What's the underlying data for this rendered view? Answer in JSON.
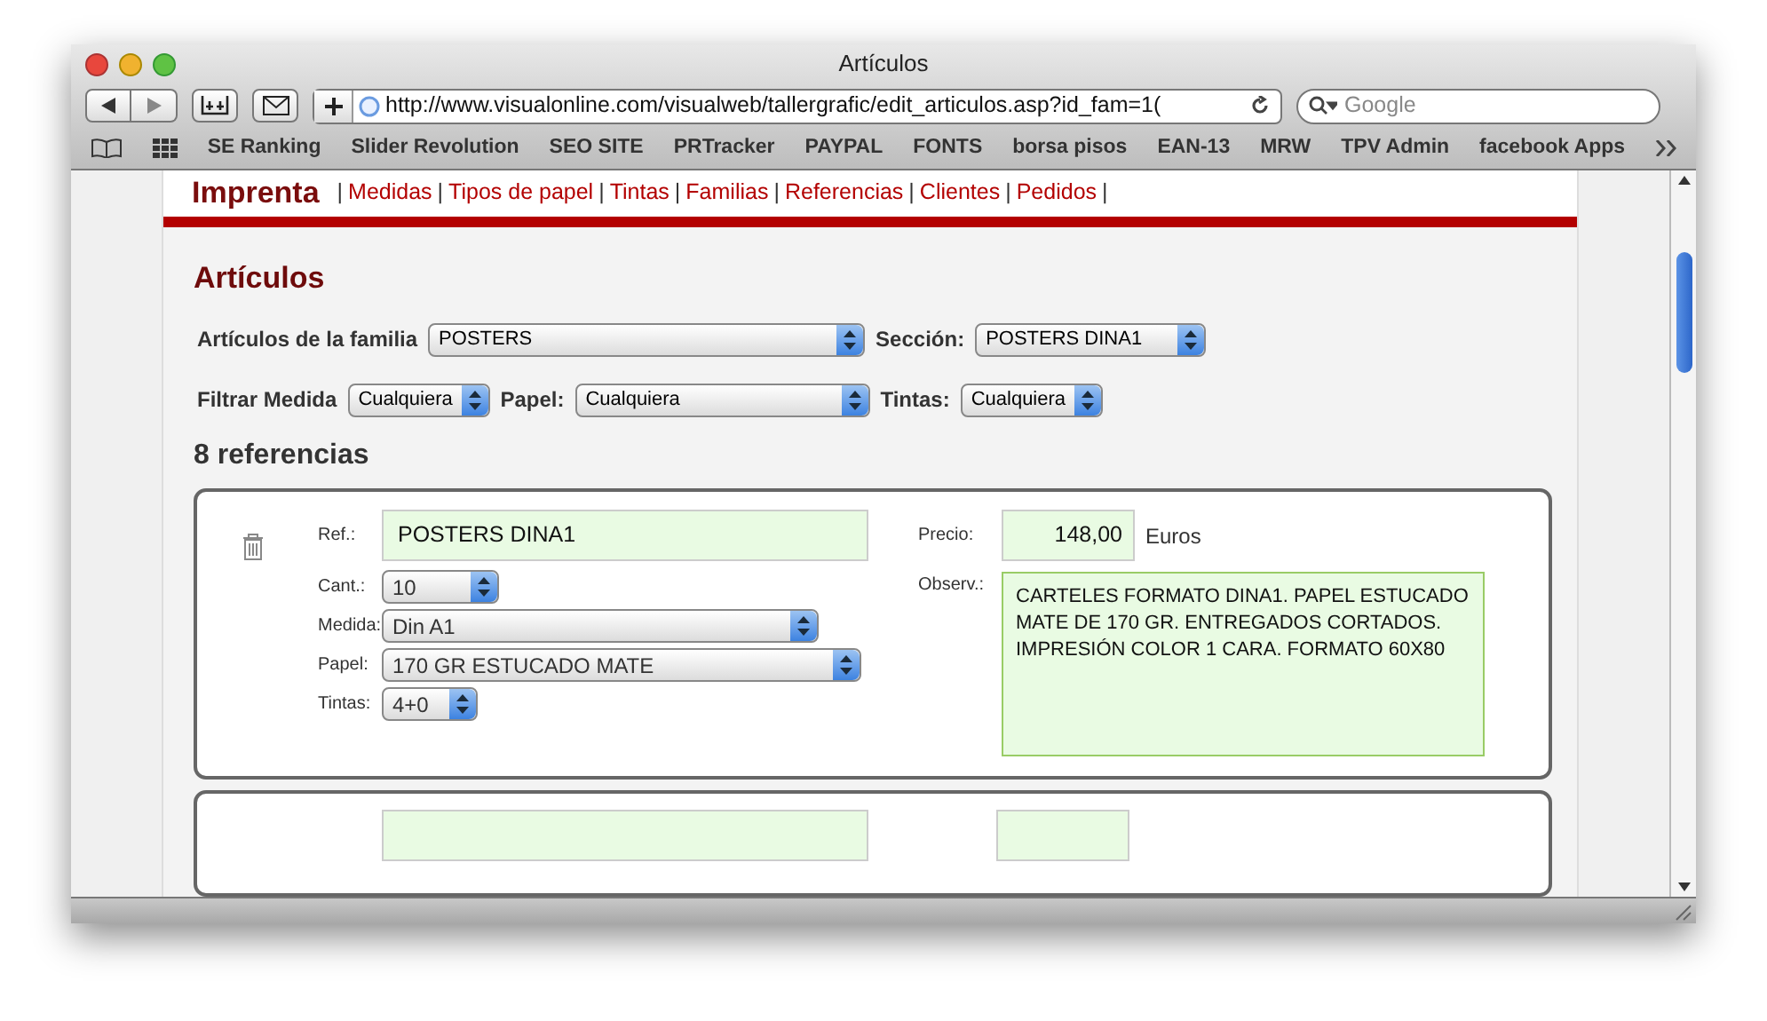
{
  "window": {
    "title": "Artículos"
  },
  "toolbar": {
    "url": "http://www.visualonline.com/visualweb/tallergrafic/edit_articulos.asp?id_fam=1(",
    "search_placeholder": "Google"
  },
  "bookmarks": [
    "SE Ranking",
    "Slider Revolution",
    "SEO SITE",
    "PRTracker",
    "PAYPAL",
    "FONTS",
    "borsa pisos",
    "EAN-13",
    "MRW",
    "TPV Admin",
    "facebook Apps"
  ],
  "page": {
    "brand": "Imprenta",
    "nav_separator": "|",
    "nav": [
      "Medidas",
      "Tipos de papel",
      "Tintas",
      "Familias",
      "Referencias",
      "Clientes",
      "Pedidos"
    ],
    "heading": "Artículos",
    "filters": [
      [
        {
          "label": "Artículos de la familia",
          "value": "POSTERS"
        },
        {
          "label": "Sección:",
          "value": "POSTERS DINA1"
        }
      ],
      [
        {
          "label": "Filtrar Medida",
          "value": "Cualquiera"
        },
        {
          "label": "Papel:",
          "value": "Cualquiera"
        },
        {
          "label": "Tintas:",
          "value": "Cualquiera"
        }
      ]
    ],
    "count": "8 referencias",
    "items": [
      {
        "ref_label": "Ref.:",
        "ref": "POSTERS DINA1",
        "cant_label": "Cant.:",
        "cant": "10",
        "medida_label": "Medida:",
        "medida": "Din A1",
        "papel_label": "Papel:",
        "papel": "170 GR ESTUCADO MATE",
        "tintas_label": "Tintas:",
        "tintas": "4+0",
        "precio_label": "Precio:",
        "precio": "148,00",
        "currency": "Euros",
        "observ_label": "Observ.:",
        "observ": "CARTELES FORMATO DINA1. PAPEL ESTUCADO MATE DE 170 GR. ENTREGADOS CORTADOS. IMPRESIÓN COLOR 1 CARA. FORMATO 60X80"
      }
    ]
  }
}
